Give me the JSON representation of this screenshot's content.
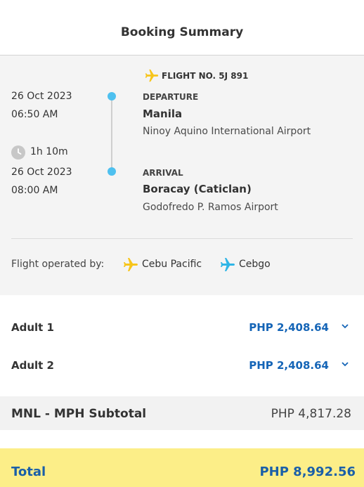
{
  "header": {
    "title": "Booking Summary"
  },
  "flight": {
    "flight_no": "FLIGHT NO. 5J 891",
    "departure": {
      "date": "26 Oct 2023",
      "time": "06:50 AM",
      "label": "DEPARTURE",
      "city": "Manila",
      "airport": "Ninoy Aquino International Airport"
    },
    "duration": "1h 10m",
    "arrival": {
      "date": "26 Oct 2023",
      "time": "08:00 AM",
      "label": "ARRIVAL",
      "city": "Boracay (Caticlan)",
      "airport": "Godofredo P. Ramos Airport"
    },
    "operated_by_label": "Flight operated by:",
    "carriers": [
      {
        "name": "Cebu Pacific",
        "icon": "plane-yellow-icon",
        "color": "#f7c51b"
      },
      {
        "name": "Cebgo",
        "icon": "plane-blue-icon",
        "color": "#2fb5e6"
      }
    ],
    "icons": {
      "flight": "plane-yellow-icon",
      "duration": "clock-icon"
    },
    "accent_color": "#4ec0ef"
  },
  "passengers": [
    {
      "label": "Adult 1",
      "price": "PHP 2,408.64",
      "icon": "chevron-down-icon"
    },
    {
      "label": "Adult 2",
      "price": "PHP 2,408.64",
      "icon": "chevron-down-icon"
    }
  ],
  "subtotal": {
    "label": "MNL - MPH Subtotal",
    "value": "PHP 4,817.28"
  },
  "total": {
    "label": "Total",
    "value": "PHP 8,992.56",
    "bg_color": "#fcee88",
    "text_color": "#1a5fa8"
  }
}
